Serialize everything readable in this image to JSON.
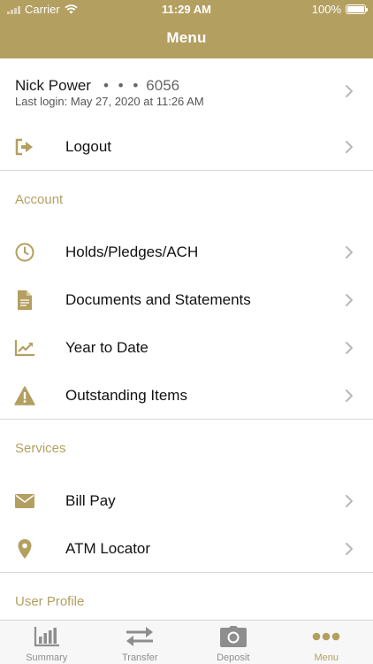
{
  "status_bar": {
    "carrier": "Carrier",
    "time": "11:29 AM",
    "battery": "100%"
  },
  "header": {
    "title": "Menu"
  },
  "user": {
    "name": "Nick Power",
    "masked": "• • •",
    "account_suffix": "6056",
    "last_login": "Last login: May 27, 2020 at 11:26 AM"
  },
  "logout": {
    "label": "Logout"
  },
  "account_section": {
    "title": "Account",
    "items": [
      {
        "label": "Holds/Pledges/ACH",
        "icon": "clock-icon"
      },
      {
        "label": "Documents and Statements",
        "icon": "document-icon"
      },
      {
        "label": "Year to Date",
        "icon": "chart-trend-icon"
      },
      {
        "label": "Outstanding Items",
        "icon": "warning-icon"
      }
    ]
  },
  "services_section": {
    "title": "Services",
    "items": [
      {
        "label": "Bill Pay",
        "icon": "envelope-icon"
      },
      {
        "label": "ATM Locator",
        "icon": "location-pin-icon"
      }
    ]
  },
  "profile_section": {
    "title": "User Profile"
  },
  "tabbar": {
    "tabs": [
      {
        "label": "Summary",
        "icon": "bar-chart-icon"
      },
      {
        "label": "Transfer",
        "icon": "transfer-arrows-icon"
      },
      {
        "label": "Deposit",
        "icon": "camera-icon"
      },
      {
        "label": "Menu",
        "icon": "more-dots-icon",
        "active": true
      }
    ]
  },
  "colors": {
    "accent": "#b39f60",
    "tab_inactive": "#8e8e8e",
    "divider": "#d8d8d8"
  }
}
